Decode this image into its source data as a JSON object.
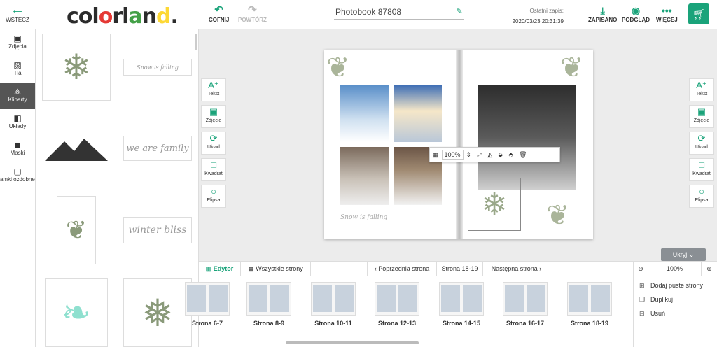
{
  "header": {
    "back_label": "WSTECZ",
    "logo": "colorland.",
    "undo_label": "COFNIJ",
    "redo_label": "POWTÓRZ",
    "project_title": "Photobook 87808",
    "last_saved_label": "Ostatni zapis:",
    "last_saved_time": "2020/03/23 20:31:39",
    "actions": [
      {
        "label": "ZAPISANO",
        "icon": "save-icon"
      },
      {
        "label": "PODGLĄD",
        "icon": "eye-icon"
      },
      {
        "label": "WIĘCEJ",
        "icon": "more-icon"
      }
    ]
  },
  "sidebar": {
    "items": [
      {
        "label": "Zdjęcia",
        "icon": "image-icon"
      },
      {
        "label": "Tła",
        "icon": "pattern-icon"
      },
      {
        "label": "Kliparty",
        "icon": "shapes-icon"
      },
      {
        "label": "Układy",
        "icon": "layout-icon"
      },
      {
        "label": "Maski",
        "icon": "mask-icon"
      },
      {
        "label": "Ramki ozdobne",
        "icon": "frame-icon"
      }
    ]
  },
  "cliparts": [
    "Snow is falling",
    "we are family",
    "winter bliss"
  ],
  "tools": [
    {
      "label": "Tekst",
      "icon": "text-icon"
    },
    {
      "label": "Zdjęcie",
      "icon": "image-add-icon"
    },
    {
      "label": "Układ",
      "icon": "refresh-icon"
    },
    {
      "label": "Kwadrat",
      "icon": "square-icon"
    },
    {
      "label": "Elipsa",
      "icon": "circle-icon"
    }
  ],
  "floating_toolbar": {
    "zoom": "100%"
  },
  "page_caption": "Snow is falling",
  "ukryj_label": "Ukryj",
  "pages_bar": {
    "editor_tab": "Edytor",
    "all_pages_tab": "Wszystkie strony",
    "prev": "Poprzednia strona",
    "current": "Strona 18-19",
    "next": "Następna strona",
    "zoom": "100%"
  },
  "thumbnails": [
    "Strona 6-7",
    "Strona 8-9",
    "Strona 10-11",
    "Strona 12-13",
    "Strona 14-15",
    "Strona 16-17",
    "Strona 18-19"
  ],
  "context_menu": [
    "Dodaj puste strony",
    "Duplikuj",
    "Usuń"
  ],
  "colors": {
    "accent": "#1aa37a"
  }
}
